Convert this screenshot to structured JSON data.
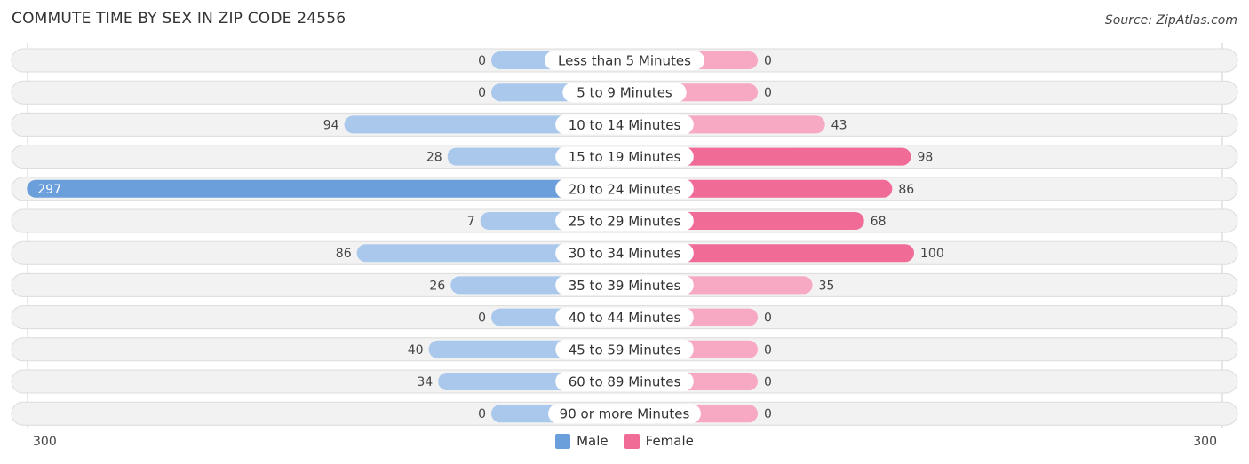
{
  "title": "COMMUTE TIME BY SEX IN ZIP CODE 24556",
  "source": "Source: ZipAtlas.com",
  "colors": {
    "male": "#6a9fdb",
    "male_light": "#a9c8ec",
    "female": "#f06b96",
    "female_light": "#f7a8c2",
    "track": "#f2f2f2"
  },
  "chart_data": {
    "type": "bar",
    "orientation": "horizontal-diverging",
    "title": "COMMUTE TIME BY SEX IN ZIP CODE 24556",
    "categories": [
      "Less than 5 Minutes",
      "5 to 9 Minutes",
      "10 to 14 Minutes",
      "15 to 19 Minutes",
      "20 to 24 Minutes",
      "25 to 29 Minutes",
      "30 to 34 Minutes",
      "35 to 39 Minutes",
      "40 to 44 Minutes",
      "45 to 59 Minutes",
      "60 to 89 Minutes",
      "90 or more Minutes"
    ],
    "series": [
      {
        "name": "Male",
        "values": [
          0,
          0,
          94,
          28,
          297,
          7,
          86,
          26,
          0,
          40,
          34,
          0
        ]
      },
      {
        "name": "Female",
        "values": [
          0,
          0,
          43,
          98,
          86,
          68,
          100,
          35,
          0,
          0,
          0,
          0
        ]
      }
    ],
    "axis": {
      "left_label": "300",
      "right_label": "300",
      "max": 300
    },
    "legend": [
      "Male",
      "Female"
    ],
    "legend_position": "bottom-center"
  }
}
